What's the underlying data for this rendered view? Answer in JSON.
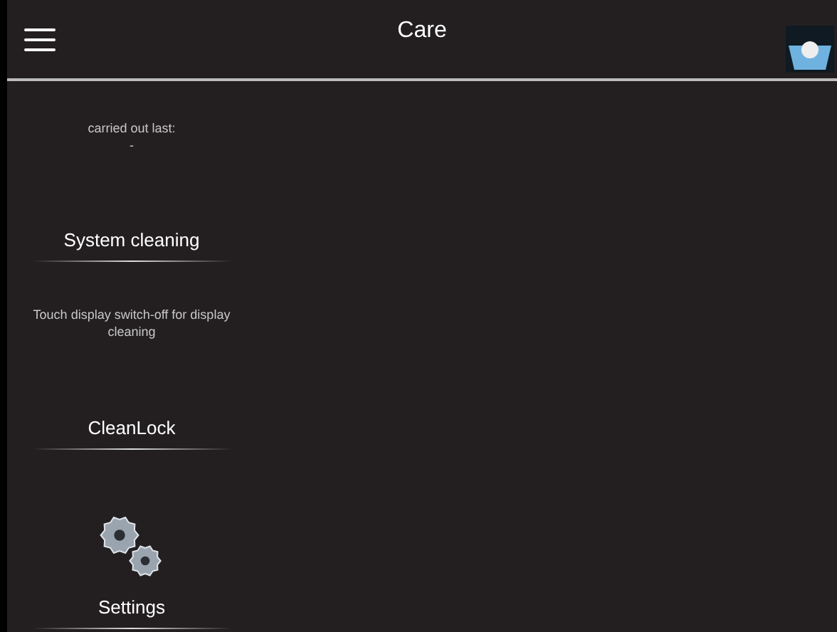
{
  "header": {
    "title": "Care"
  },
  "actions": [
    {
      "kind": "text",
      "caption": [
        "carried out last:",
        "-"
      ],
      "label": "System cleaning"
    },
    {
      "kind": "text",
      "caption": [
        "Touch display switch-off for display cleaning"
      ],
      "label": "CleanLock"
    },
    {
      "kind": "icon",
      "label": "Settings"
    }
  ]
}
